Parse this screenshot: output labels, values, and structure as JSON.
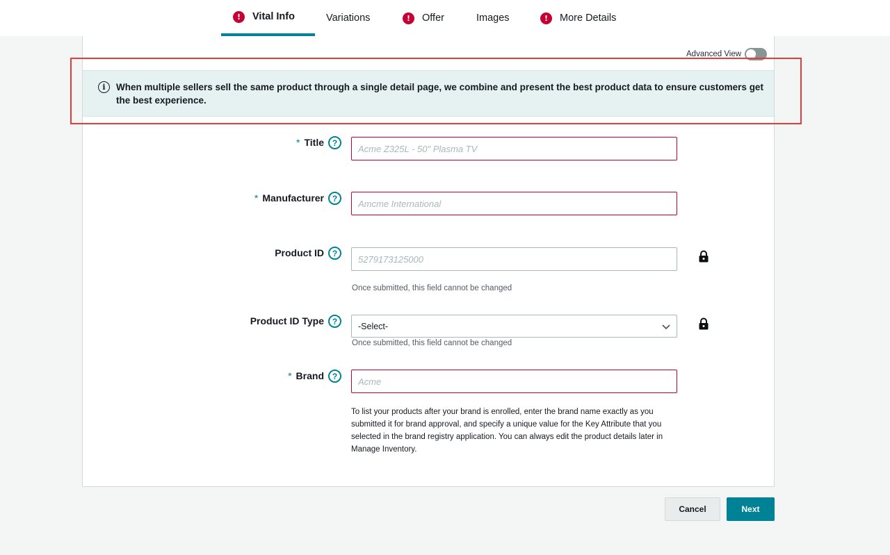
{
  "tabs": [
    {
      "label": "Vital Info",
      "error": true,
      "active": true
    },
    {
      "label": "Variations",
      "error": false,
      "active": false
    },
    {
      "label": "Offer",
      "error": true,
      "active": false
    },
    {
      "label": "Images",
      "error": false,
      "active": false
    },
    {
      "label": "More Details",
      "error": true,
      "active": false
    }
  ],
  "advanced_view": {
    "label": "Advanced View",
    "enabled": false
  },
  "info_banner": {
    "text": "When multiple sellers sell the same product through a single detail page, we combine and present the best product data to ensure customers get the best experience."
  },
  "form": {
    "title": {
      "label": "Title",
      "required": true,
      "placeholder": "Acme Z325L - 50\" Plasma TV"
    },
    "manufacturer": {
      "label": "Manufacturer",
      "required": true,
      "placeholder": "Amcme International"
    },
    "product_id": {
      "label": "Product ID",
      "required": false,
      "placeholder": "5279173125000",
      "hint": "Once submitted, this field cannot be changed"
    },
    "product_id_type": {
      "label": "Product ID Type",
      "required": false,
      "selected": "-Select-",
      "hint": "Once submitted, this field cannot be changed"
    },
    "brand": {
      "label": "Brand",
      "required": true,
      "placeholder": "Acme",
      "note": "To list your products after your brand is enrolled, enter the brand name exactly as you submitted it for brand approval, and specify a unique value for the Key Attribute that you selected in the brand registry application. You can always edit the product details later in Manage Inventory."
    }
  },
  "buttons": {
    "cancel": "Cancel",
    "next": "Next"
  },
  "glyphs": {
    "error": "!",
    "help": "?",
    "info": "i",
    "required": "*"
  },
  "colors": {
    "accent": "#008296",
    "error": "#c40035",
    "highlight": "#e23c3c"
  }
}
